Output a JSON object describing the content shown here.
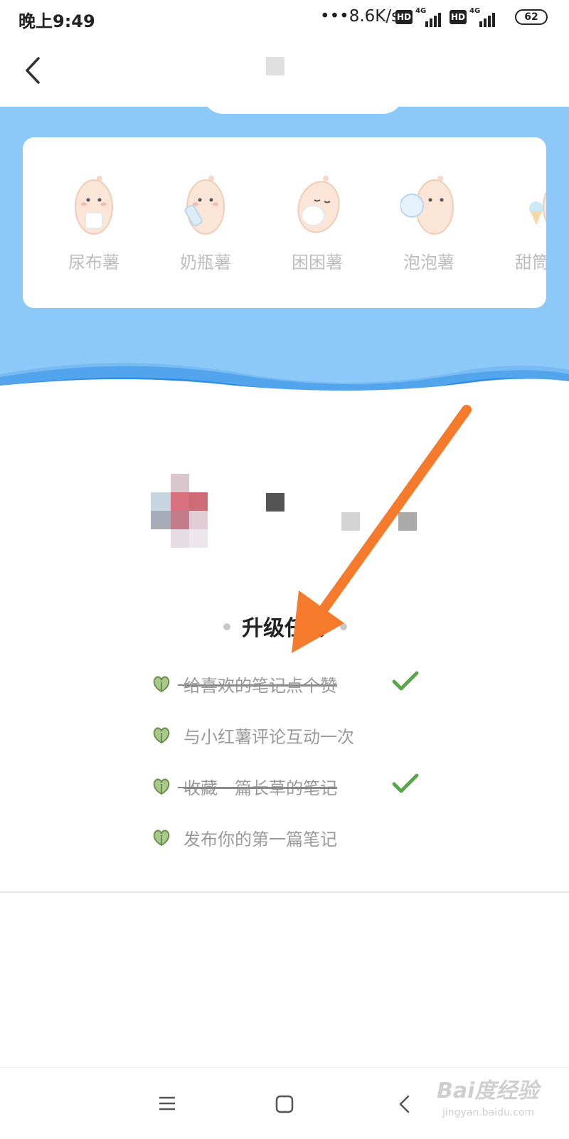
{
  "status_bar": {
    "time": "晚上9:49",
    "network_speed": "•••8.6K/s",
    "hd_label": "HD",
    "net_type": "4G",
    "battery": "62"
  },
  "levels": [
    {
      "label": "尿布薯"
    },
    {
      "label": "奶瓶薯"
    },
    {
      "label": "困困薯"
    },
    {
      "label": "泡泡薯"
    },
    {
      "label": "甜筒薯"
    }
  ],
  "upgrade": {
    "title": "升级任务",
    "tasks": [
      {
        "text": "给喜欢的笔记点个赞",
        "done": true
      },
      {
        "text": "与小红薯评论互动一次",
        "done": false
      },
      {
        "text": "收藏一篇长草的笔记",
        "done": true
      },
      {
        "text": "发布你的第一篇笔记",
        "done": false
      }
    ]
  },
  "colors": {
    "sky": "#8cc8f8",
    "wave": "#2f8fe8",
    "check": "#5aa54e",
    "arrow": "#f57a2b",
    "sprout": "#7fa85c"
  },
  "watermark": {
    "text": "Bai度经验",
    "url": "jingyan.baidu.com"
  }
}
